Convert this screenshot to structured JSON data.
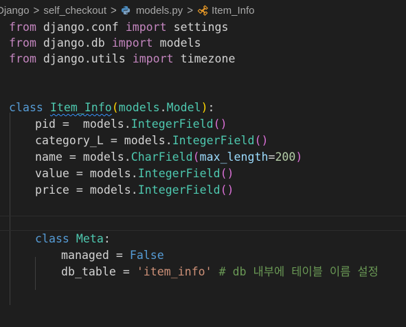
{
  "breadcrumb": {
    "items": [
      "Django",
      "self_checkout",
      "models.py",
      "Item_Info"
    ],
    "separator": ">"
  },
  "code": {
    "line1": {
      "kw": "from",
      "mod": " django.conf ",
      "kw2": "import",
      "name": " settings"
    },
    "line2": {
      "kw": "from",
      "mod": " django.db ",
      "kw2": "import",
      "name": " models"
    },
    "line3": {
      "kw": "from",
      "mod": " django.utils ",
      "kw2": "import",
      "name": " timezone"
    },
    "line6": {
      "kw": "class",
      "name": "Item_Info",
      "open": "(",
      "base_mod": "models",
      "dot": ".",
      "base_cls": "Model",
      "close": ")",
      "colon": ":"
    },
    "line7": {
      "name": "pid = ",
      "mod": " models.",
      "fn": "IntegerField",
      "paren": "()"
    },
    "line8": {
      "name": "category_L = models.",
      "fn": "IntegerField",
      "paren": "()"
    },
    "line9": {
      "name": "name = models.",
      "fn": "CharField",
      "open": "(",
      "param": "max_length",
      "eq": "=",
      "num": "200",
      "close": ")"
    },
    "line10": {
      "name": "value = models.",
      "fn": "IntegerField",
      "paren": "()"
    },
    "line11": {
      "name": "price = models.",
      "fn": "IntegerField",
      "paren": "()"
    },
    "line14": {
      "kw": "class",
      "name": "Meta",
      "colon": ":"
    },
    "line15": {
      "name": "managed = ",
      "val": "False"
    },
    "line16": {
      "name": "db_table = ",
      "str": "'item_info'",
      "comment": " # db 내부에 테이블 이름 설정"
    }
  },
  "colors": {
    "background": "#1e1e1e",
    "keyword_import": "#c586c0",
    "keyword_class": "#569cd6",
    "class_name": "#4ec9b0",
    "function": "#dcdcaa",
    "parameter": "#9cdcfe",
    "number": "#b5cea8",
    "string": "#ce9178",
    "comment": "#6a9955"
  },
  "icons": {
    "file": "python-file-icon",
    "symbol": "class-symbol-icon"
  }
}
